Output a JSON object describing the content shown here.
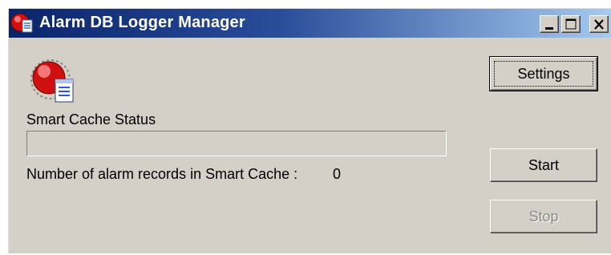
{
  "window": {
    "title": "Alarm DB Logger Manager",
    "title_bar_color": "#0a246a",
    "caption_buttons": [
      "minimize-icon",
      "maximize-icon",
      "close-icon"
    ]
  },
  "main": {
    "app_icon": "alarm-logger-icon",
    "cache_status_label": "Smart Cache Status",
    "cache_progress": 0,
    "records_label": "Number of alarm records in Smart Cache :",
    "records_count": "0"
  },
  "buttons": {
    "settings": "Settings",
    "start": "Start",
    "stop": "Stop",
    "stop_enabled": false
  }
}
